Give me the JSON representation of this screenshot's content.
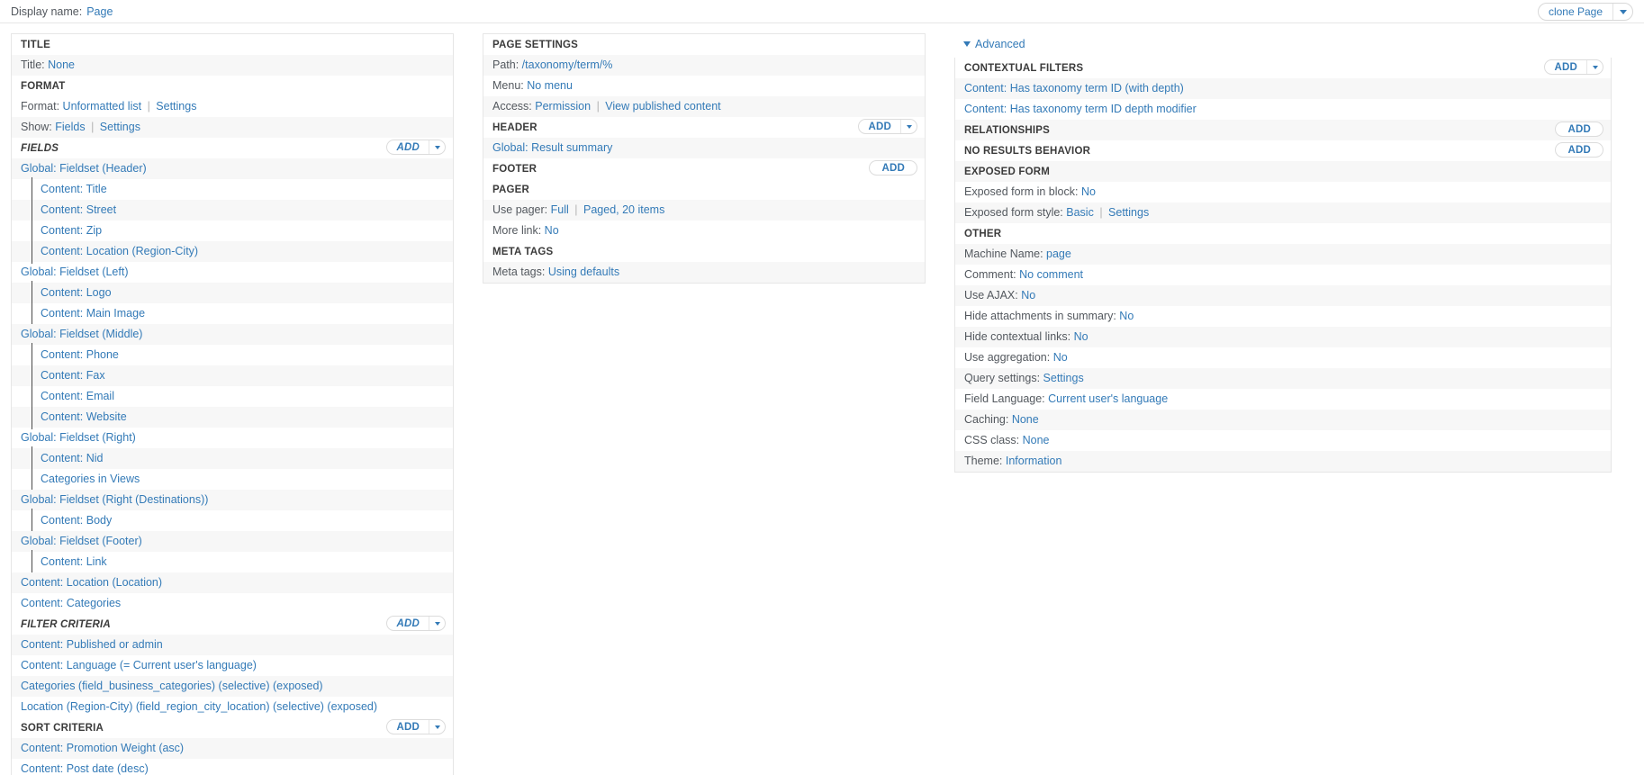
{
  "topbar": {
    "display_name_label": "Display name:",
    "display_name_value": "Page",
    "clone_label": "clone Page"
  },
  "left": {
    "title_section": {
      "heading": "TITLE",
      "rows": [
        {
          "key": "Title:",
          "links": [
            "None"
          ]
        }
      ]
    },
    "format_section": {
      "heading": "FORMAT",
      "rows": [
        {
          "key": "Format:",
          "links": [
            "Unformatted list",
            "Settings"
          ]
        },
        {
          "key": "Show:",
          "links": [
            "Fields",
            "Settings"
          ]
        }
      ]
    },
    "fields_section": {
      "heading": "FIELDS",
      "add_label": "Add",
      "items": [
        {
          "label": "Global: Fieldset (Header)",
          "indent": false
        },
        {
          "label": "Content: Title",
          "indent": true
        },
        {
          "label": "Content: Street",
          "indent": true
        },
        {
          "label": "Content: Zip",
          "indent": true
        },
        {
          "label": "Content: Location (Region-City)",
          "indent": true
        },
        {
          "label": "Global: Fieldset (Left)",
          "indent": false
        },
        {
          "label": "Content: Logo",
          "indent": true
        },
        {
          "label": "Content: Main Image",
          "indent": true
        },
        {
          "label": "Global: Fieldset (Middle)",
          "indent": false
        },
        {
          "label": "Content: Phone",
          "indent": true
        },
        {
          "label": "Content: Fax",
          "indent": true
        },
        {
          "label": "Content: Email",
          "indent": true
        },
        {
          "label": "Content: Website",
          "indent": true
        },
        {
          "label": "Global: Fieldset (Right)",
          "indent": false
        },
        {
          "label": "Content: Nid",
          "indent": true
        },
        {
          "label": "Categories in Views",
          "indent": true
        },
        {
          "label": "Global: Fieldset (Right (Destinations))",
          "indent": false
        },
        {
          "label": "Content: Body",
          "indent": true
        },
        {
          "label": "Global: Fieldset (Footer)",
          "indent": false
        },
        {
          "label": "Content: Link",
          "indent": true
        },
        {
          "label": "Content: Location (Location)",
          "indent": false
        },
        {
          "label": "Content: Categories",
          "indent": false
        }
      ]
    },
    "filter_section": {
      "heading": "FILTER CRITERIA",
      "add_label": "Add",
      "items": [
        {
          "label": "Content: Published or admin"
        },
        {
          "label": "Content: Language (= Current user's language)"
        },
        {
          "label": "Categories (field_business_categories) (selective) (exposed)"
        },
        {
          "label": "Location (Region-City) (field_region_city_location) (selective) (exposed)"
        }
      ]
    },
    "sort_section": {
      "heading": "SORT CRITERIA",
      "add_label": "Add",
      "items": [
        {
          "label": "Content: Promotion Weight (asc)"
        },
        {
          "label": "Content: Post date (desc)"
        }
      ]
    }
  },
  "middle": {
    "page_settings": {
      "heading": "PAGE SETTINGS",
      "rows": [
        {
          "key": "Path:",
          "links": [
            "/taxonomy/term/%"
          ]
        },
        {
          "key": "Menu:",
          "links": [
            "No menu"
          ]
        },
        {
          "key": "Access:",
          "links": [
            "Permission",
            "View published content"
          ]
        }
      ]
    },
    "header_section": {
      "heading": "HEADER",
      "add_label": "Add",
      "items": [
        {
          "label": "Global: Result summary"
        }
      ]
    },
    "footer_section": {
      "heading": "FOOTER",
      "add_label": "Add",
      "items": []
    },
    "pager_section": {
      "heading": "PAGER",
      "rows": [
        {
          "key": "Use pager:",
          "links": [
            "Full",
            "Paged, 20 items"
          ]
        },
        {
          "key": "More link:",
          "links": [
            "No"
          ]
        }
      ]
    },
    "meta_section": {
      "heading": "META TAGS",
      "rows": [
        {
          "key": "Meta tags:",
          "links": [
            "Using defaults"
          ]
        }
      ]
    }
  },
  "right": {
    "advanced_label": "Advanced",
    "contextual_filters": {
      "heading": "CONTEXTUAL FILTERS",
      "add_label": "Add",
      "items": [
        {
          "label": "Content: Has taxonomy term ID (with depth)"
        },
        {
          "label": "Content: Has taxonomy term ID depth modifier"
        }
      ]
    },
    "relationships": {
      "heading": "RELATIONSHIPS",
      "add_label": "Add",
      "items": []
    },
    "no_results": {
      "heading": "NO RESULTS BEHAVIOR",
      "add_label": "Add",
      "items": []
    },
    "exposed_form": {
      "heading": "EXPOSED FORM",
      "rows": [
        {
          "key": "Exposed form in block:",
          "links": [
            "No"
          ]
        },
        {
          "key": "Exposed form style:",
          "links": [
            "Basic",
            "Settings"
          ]
        }
      ]
    },
    "other": {
      "heading": "OTHER",
      "rows": [
        {
          "key": "Machine Name:",
          "links": [
            "page"
          ]
        },
        {
          "key": "Comment:",
          "links": [
            "No comment"
          ]
        },
        {
          "key": "Use AJAX:",
          "links": [
            "No"
          ]
        },
        {
          "key": "Hide attachments in summary:",
          "links": [
            "No"
          ]
        },
        {
          "key": "Hide contextual links:",
          "links": [
            "No"
          ]
        },
        {
          "key": "Use aggregation:",
          "links": [
            "No"
          ]
        },
        {
          "key": "Query settings:",
          "links": [
            "Settings"
          ]
        },
        {
          "key": "Field Language:",
          "links": [
            "Current user's language"
          ]
        },
        {
          "key": "Caching:",
          "links": [
            "None"
          ]
        },
        {
          "key": "CSS class:",
          "links": [
            "None"
          ]
        },
        {
          "key": "Theme:",
          "links": [
            "Information"
          ]
        }
      ]
    }
  }
}
